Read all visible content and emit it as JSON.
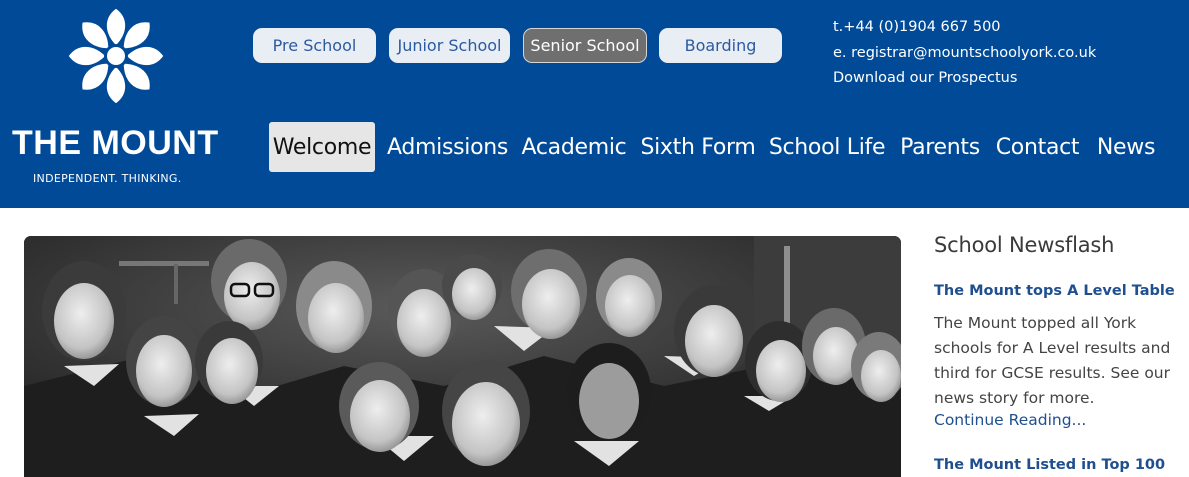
{
  "brand": {
    "name": "THE MOUNT",
    "tagline": "INDEPENDENT. THINKING.",
    "logo_icon": "rose-emblem-icon"
  },
  "school_nav": [
    {
      "label": "Pre School",
      "active": false
    },
    {
      "label": "Junior School",
      "active": false
    },
    {
      "label": "Senior School",
      "active": true
    },
    {
      "label": "Boarding",
      "active": false
    }
  ],
  "contact": {
    "phone": "t.+44 (0)1904 667 500",
    "email": "e. registrar@mountschoolyork.co.uk",
    "prospectus": "Download our Prospectus"
  },
  "main_nav": [
    {
      "label": "Welcome",
      "active": true
    },
    {
      "label": "Admissions",
      "active": false
    },
    {
      "label": "Academic",
      "active": false
    },
    {
      "label": "Sixth Form",
      "active": false
    },
    {
      "label": "School Life",
      "active": false
    },
    {
      "label": "Parents",
      "active": false
    },
    {
      "label": "Contact",
      "active": false
    },
    {
      "label": "News",
      "active": false
    }
  ],
  "newsflash": {
    "title": "School Newsflash",
    "items": [
      {
        "headline": "The Mount tops A Level Table",
        "body": "The Mount topped all York schools for A Level results and third for GCSE results. See our news story for more.",
        "link": "Continue Reading..."
      },
      {
        "headline": "The Mount Listed in Top 100"
      }
    ]
  },
  "colors": {
    "header_bg": "#004a98",
    "link": "#1f4f8f",
    "active_school_btn": "#6f6f6f"
  }
}
